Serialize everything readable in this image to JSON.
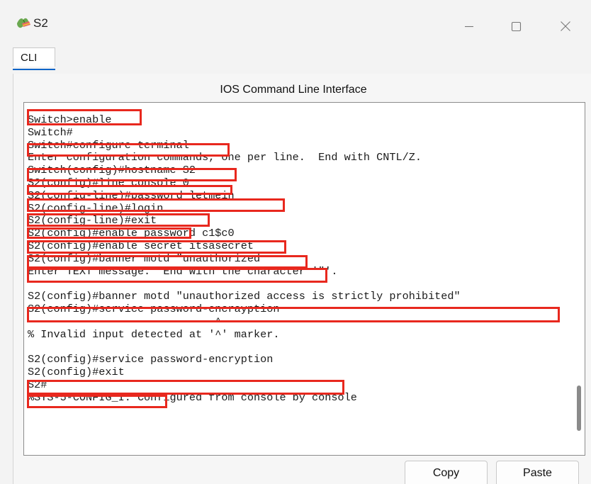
{
  "window": {
    "title": "S2",
    "icon": "packet-tracer-switch-icon",
    "controls": [
      "minimize-icon",
      "maximize-icon",
      "close-icon"
    ]
  },
  "tabs": [
    {
      "label": "CLI",
      "active": true
    }
  ],
  "panel": {
    "title": "IOS Command Line Interface"
  },
  "terminal": {
    "lines": [
      "Switch>enable",
      "Switch#",
      "Switch#configure terminal",
      "Enter configuration commands, one per line.  End with CNTL/Z.",
      "Switch(config)#hostname S2",
      "S2(config)#line console 0",
      "S2(config-line)#password letmein",
      "S2(config-line)#login",
      "S2(config-line)#exit",
      "S2(config)#enable password c1$c0",
      "S2(config)#enable secret itsasecret",
      "S2(config)#banner motd \"unauthorized",
      "Enter TEXT message.  End with the character '\"'.",
      "",
      "S2(config)#banner motd \"unauthorized access is strictly prohibited\"",
      "S2(config)#service password-encrayption",
      "                             ^",
      "% Invalid input detected at '^' marker.",
      "",
      "S2(config)#service password-encryption",
      "S2(config)#exit",
      "S2#",
      "%SYS-5-CONFIG_I: Configured from console by console"
    ],
    "highlight_color": "#e8281e"
  },
  "buttons": {
    "copy_label": "Copy",
    "paste_label": "Paste"
  }
}
